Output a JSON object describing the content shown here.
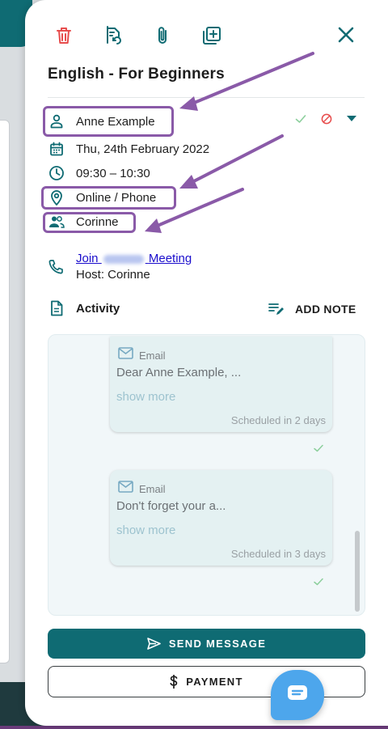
{
  "panel": {
    "title": "English - For Beginners"
  },
  "toolbar": {
    "icons": [
      "trash-icon",
      "reschedule-icon",
      "attachment-icon",
      "duplicate-icon"
    ],
    "close_icon": "close-icon"
  },
  "details": {
    "client": "Anne Example",
    "date": "Thu, 24th February 2022",
    "time": "09:30 – 10:30",
    "location": "Online / Phone",
    "staff": "Corinne"
  },
  "meeting": {
    "join_prefix": "Join",
    "join_suffix": "Meeting",
    "host": "Host: Corinne"
  },
  "activity": {
    "label": "Activity",
    "add_note_label": "ADD NOTE",
    "messages": [
      {
        "type": "Email",
        "preview": "Dear Anne Example, ...",
        "more": "show more",
        "schedule": "Scheduled in 2 days"
      },
      {
        "type": "Email",
        "preview": "Don't forget your a...",
        "more": "show more",
        "schedule": "Scheduled in 3 days"
      }
    ]
  },
  "actions": {
    "send_label": "SEND MESSAGE",
    "payment_label": "PAYMENT"
  },
  "colors": {
    "brand_teal": "#0f6b73",
    "delete_red": "#e74c4c",
    "highlight_purple": "#8a5aa8",
    "chat_blue": "#4da6ec"
  }
}
